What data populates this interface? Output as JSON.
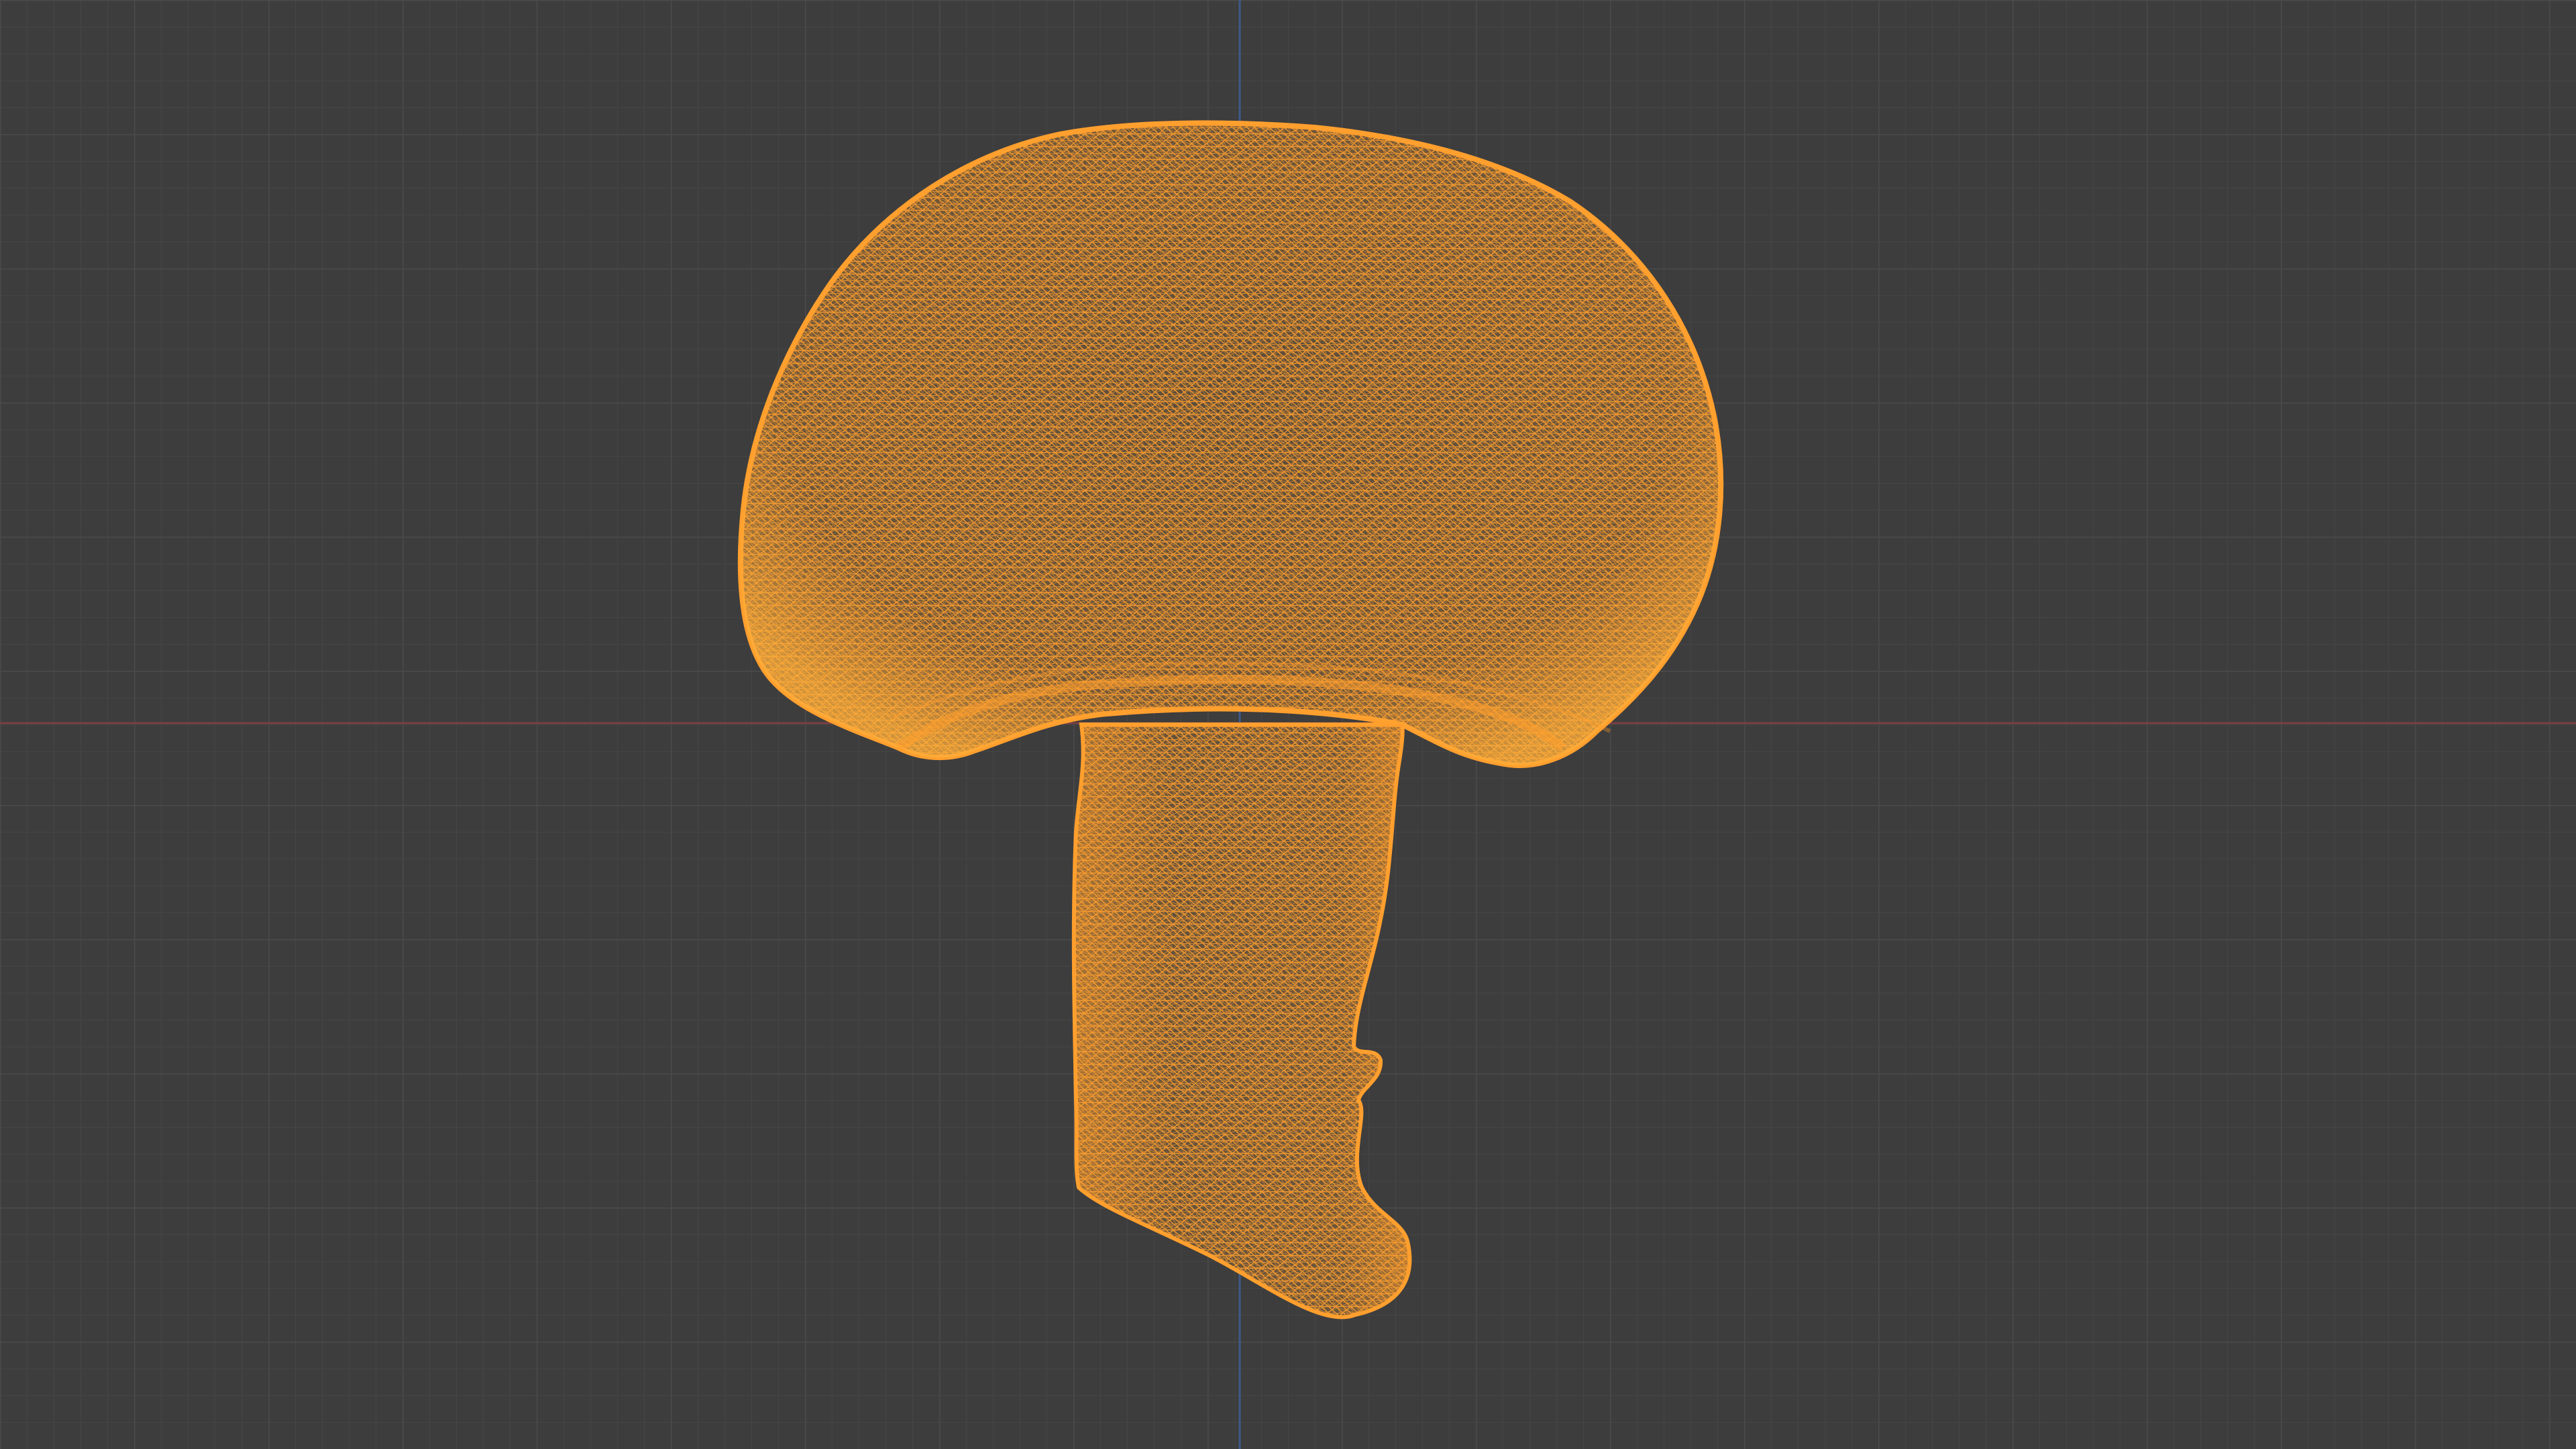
{
  "viewport": {
    "mode": "wireframe",
    "background_color": "#3d3d3d",
    "grid_minor_color": "#454545",
    "grid_major_color": "#4a4a4a",
    "x_axis_color": "#7a3f44",
    "y_axis_color": "#3d5a8a",
    "wire_color": "#ff9f2e",
    "grid_visible": true
  },
  "object": {
    "name": "mushroom",
    "selected": true
  }
}
